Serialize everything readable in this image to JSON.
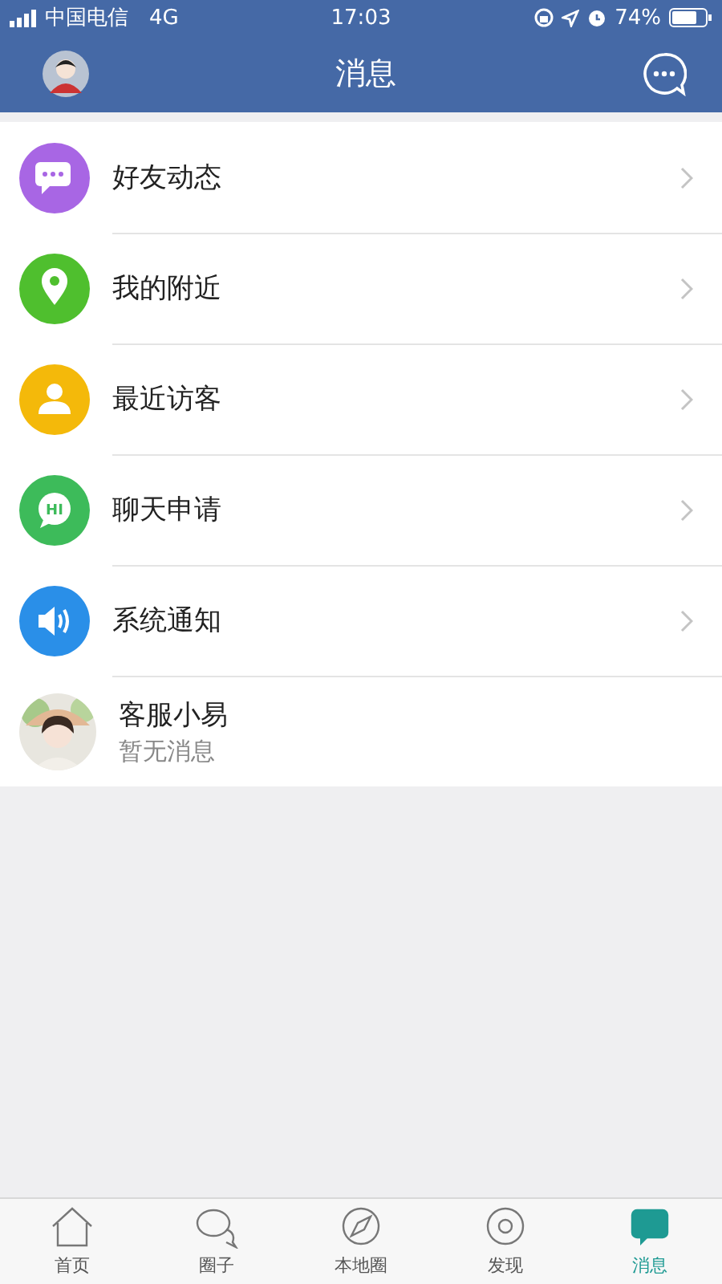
{
  "status_bar": {
    "carrier": "中国电信",
    "network": "4G",
    "time": "17:03",
    "battery": "74%"
  },
  "nav_bar": {
    "title": "消息"
  },
  "items": [
    {
      "kind": "chat",
      "label": "好友动态",
      "color": "#a866e4"
    },
    {
      "kind": "location",
      "label": "我的附近",
      "color": "#4fbf2e"
    },
    {
      "kind": "person",
      "label": "最近访客",
      "color": "#f4b90a"
    },
    {
      "kind": "hi",
      "label": "聊天申请",
      "color": "#3dbb5a",
      "icon_text": "HI"
    },
    {
      "kind": "speaker",
      "label": "系统通知",
      "color": "#2a8fe8"
    },
    {
      "kind": "contact",
      "label": "客服小易",
      "subtitle": "暂无消息"
    }
  ],
  "tab_bar": [
    {
      "kind": "home",
      "label": "首页",
      "selected": false
    },
    {
      "kind": "bubbles",
      "label": "圈子",
      "selected": false
    },
    {
      "kind": "compass",
      "label": "本地圈",
      "selected": false
    },
    {
      "kind": "discover",
      "label": "发现",
      "selected": false
    },
    {
      "kind": "message",
      "label": "消息",
      "selected": true
    }
  ]
}
